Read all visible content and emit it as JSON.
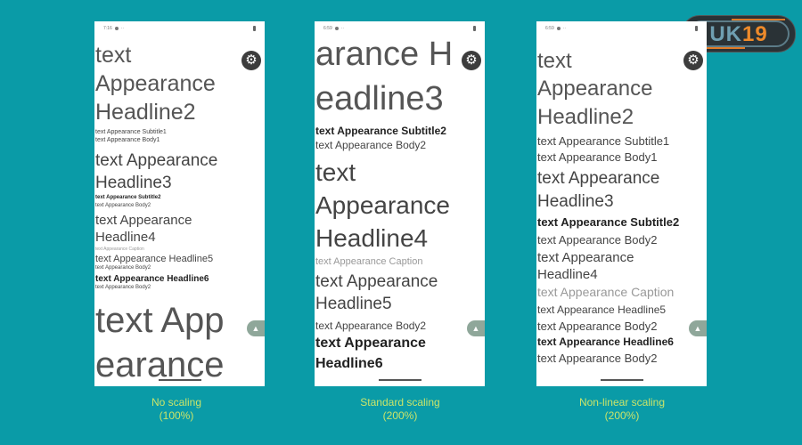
{
  "phones": [
    {
      "status_time": "7:16",
      "lines": [
        {
          "text": "text",
          "role": "headline2"
        },
        {
          "text": "Appearance",
          "role": "headline2"
        },
        {
          "text": "Headline2",
          "role": "headline2"
        },
        {
          "text": "text Appearance Subtitle1",
          "role": "subtitle1"
        },
        {
          "text": "text Appearance Body1",
          "role": "body1"
        },
        {
          "text": "text Appearance",
          "role": "headline3"
        },
        {
          "text": "Headline3",
          "role": "headline3"
        },
        {
          "text": "text Appearance Subtitle2",
          "role": "subtitle2"
        },
        {
          "text": "text Appearance Body2",
          "role": "body2"
        },
        {
          "text": "text Appearance",
          "role": "headline4"
        },
        {
          "text": "Headline4",
          "role": "headline4"
        },
        {
          "text": "text Appearance Caption",
          "role": "caption"
        },
        {
          "text": "text Appearance Headline5",
          "role": "headline5"
        },
        {
          "text": "text Appearance Body2",
          "role": "body2"
        },
        {
          "text": "text Appearance Headline6",
          "role": "headline6"
        },
        {
          "text": "text Appearance Body2",
          "role": "body2"
        },
        {
          "text": "text App",
          "role": "headline1"
        },
        {
          "text": "earance",
          "role": "headline1"
        }
      ],
      "caption": "No scaling",
      "scale": "(100%)"
    },
    {
      "status_time": "6:59",
      "lines": [
        {
          "text": "arance H",
          "role": "headline3"
        },
        {
          "text": "eadline3",
          "role": "headline3"
        },
        {
          "text": "text Appearance Subtitle2",
          "role": "subtitle2"
        },
        {
          "text": "text Appearance Body2",
          "role": "body2"
        },
        {
          "text": "text",
          "role": "headline4"
        },
        {
          "text": "Appearance",
          "role": "headline4"
        },
        {
          "text": "Headline4",
          "role": "headline4"
        },
        {
          "text": "text Appearance Caption",
          "role": "caption"
        },
        {
          "text": "text Appearance",
          "role": "headline5"
        },
        {
          "text": "Headline5",
          "role": "headline5"
        },
        {
          "text": "text Appearance Body2",
          "role": "body2"
        },
        {
          "text": "text Appearance",
          "role": "headline6"
        },
        {
          "text": "Headline6",
          "role": "headline6"
        }
      ],
      "caption": "Standard scaling",
      "scale": "(200%)"
    },
    {
      "status_time": "6:59",
      "lines": [
        {
          "text": "text",
          "role": "headline2"
        },
        {
          "text": "Appearance",
          "role": "headline2"
        },
        {
          "text": "Headline2",
          "role": "headline2"
        },
        {
          "text": "text Appearance Subtitle1",
          "role": "subtitle1"
        },
        {
          "text": "text Appearance Body1",
          "role": "body1"
        },
        {
          "text": "text Appearance",
          "role": "headline3"
        },
        {
          "text": "Headline3",
          "role": "headline3"
        },
        {
          "text": "text Appearance Subtitle2",
          "role": "subtitle2"
        },
        {
          "text": "text Appearance Body2",
          "role": "body2"
        },
        {
          "text": "text Appearance",
          "role": "headline4"
        },
        {
          "text": "Headline4",
          "role": "headline4"
        },
        {
          "text": "text Appearance Caption",
          "role": "caption"
        },
        {
          "text": "text Appearance Headline5",
          "role": "headline5"
        },
        {
          "text": "text Appearance Body2",
          "role": "body2"
        },
        {
          "text": "text Appearance Headline6",
          "role": "headline6"
        },
        {
          "text": "text Appearance Body2",
          "role": "body2"
        }
      ],
      "caption": "Non-linear scaling",
      "scale": "(200%)"
    }
  ],
  "icons": {
    "settings": "gear-icon",
    "android": "android-icon"
  },
  "logo": {
    "part1": "UK",
    "part2": "19"
  },
  "colors": {
    "background": "#0a9ba7",
    "caption": "#c9e46a",
    "logo_orange": "#ee8a2a",
    "logo_blue": "#6f9fb1"
  }
}
